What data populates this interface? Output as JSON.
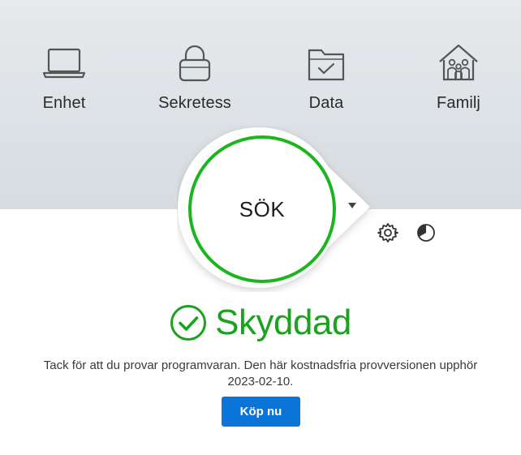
{
  "features": [
    {
      "label": "Enhet",
      "icon": "laptop-icon"
    },
    {
      "label": "Sekretess",
      "icon": "lock-icon"
    },
    {
      "label": "Data",
      "icon": "folder-check-icon"
    },
    {
      "label": "Familj",
      "icon": "family-house-icon"
    }
  ],
  "scan": {
    "label": "SÖK",
    "menu_icon": "dropdown-arrow-icon"
  },
  "tools": {
    "settings_icon": "gear-icon",
    "performance_icon": "pie-chart-icon"
  },
  "status": {
    "label": "Skyddad",
    "icon": "check-circle-icon"
  },
  "notice": {
    "line1": "Tack för att du provar programvaran. Den här kostnadsfria provversionen upphör",
    "line2": "2023-02-10."
  },
  "buy_button": {
    "label": "Köp nu"
  },
  "colors": {
    "accent_green": "#1db51f",
    "status_green": "#1aa31c",
    "button_blue": "#0a74d8"
  }
}
